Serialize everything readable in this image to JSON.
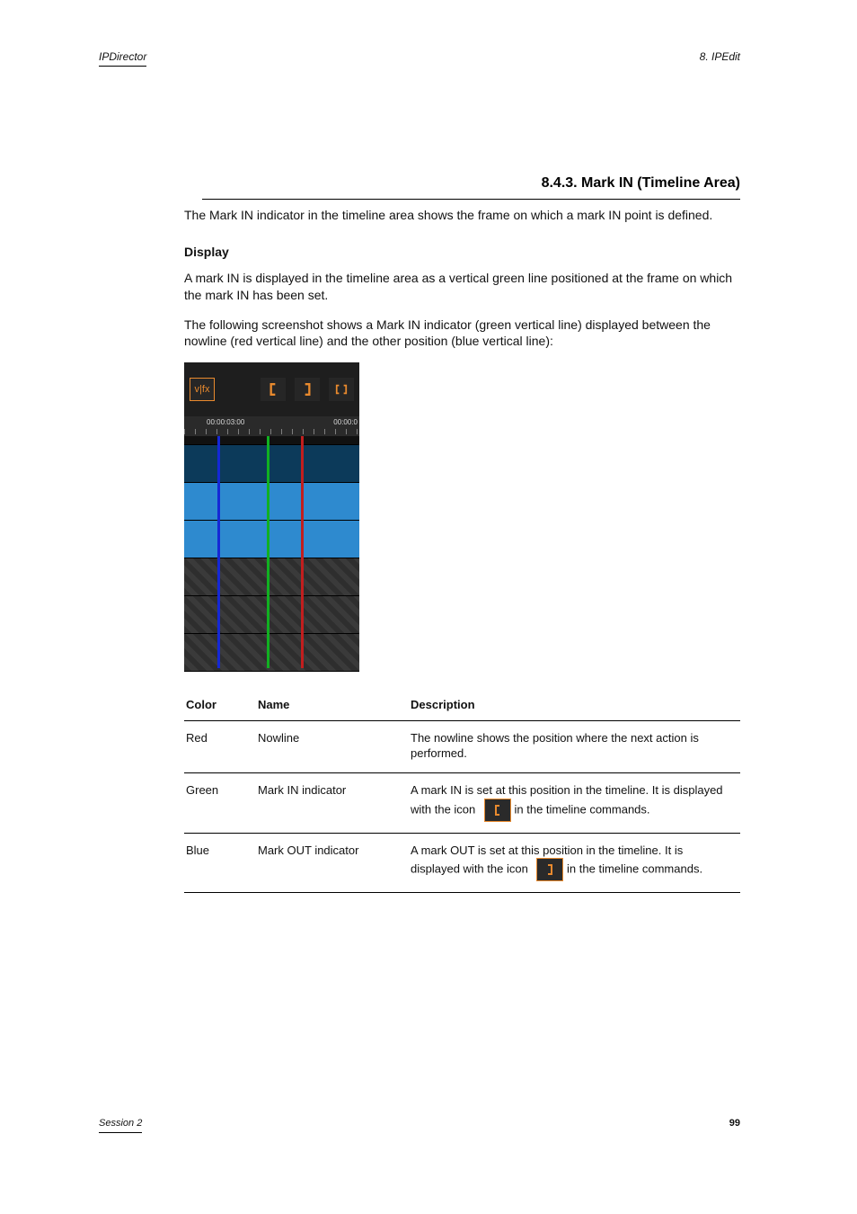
{
  "meta": {
    "product_line": "IPDirector",
    "page_label": "8. IPEdit"
  },
  "section_heading": "8.4.3. Mark IN (Timeline Area)",
  "paragraphs": {
    "intro": "The Mark IN indicator in the timeline area shows the frame on which a mark IN point is defined.",
    "display_h": "Display",
    "display_p1": "A mark IN is displayed in the timeline area as a vertical green line positioned at the frame on which the mark IN has been set.",
    "display_p2": "The following screenshot shows a Mark IN indicator (green vertical line) displayed between the nowline (red vertical line) and the other position (blue vertical line):"
  },
  "figure": {
    "toolbar": {
      "vfx_label": "v|fx"
    },
    "ruler": {
      "tc_left": "00:00:03:00",
      "tc_right": "00:00:0"
    }
  },
  "table": {
    "headers": {
      "c1": "Color",
      "c2": "Name",
      "c3": "Description"
    },
    "rows": [
      {
        "color": "Red",
        "name": "Nowline",
        "desc": "The nowline shows the position where the next action is performed."
      },
      {
        "color": "Green",
        "name": "Mark IN indicator",
        "desc_a": "A mark IN is set at this position in the timeline. It is displayed with the icon ",
        "desc_b": " in the timeline commands."
      },
      {
        "color": "Blue",
        "name": "Mark OUT indicator",
        "desc_a": "A mark OUT is set at this position in the timeline. It is displayed with the icon ",
        "desc_b": " in the timeline commands."
      }
    ]
  },
  "footer": {
    "left": "Session 2",
    "right": "99"
  }
}
